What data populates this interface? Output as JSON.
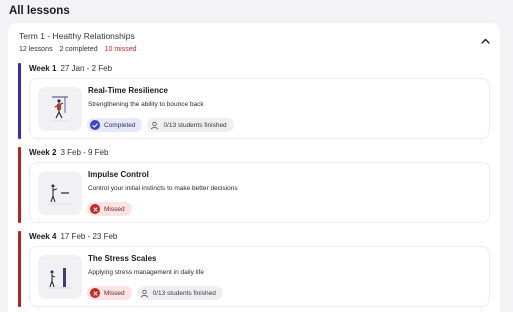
{
  "page": {
    "title": "All lessons"
  },
  "term": {
    "title": "Term 1 - Healthy Relationships",
    "lessons_count": "12 lessons",
    "completed_count": "2 completed",
    "missed_count": "10 missed"
  },
  "weeks": [
    {
      "label": "Week 1",
      "dates": "27 Jan - 2 Feb",
      "accent": "#3b2db3",
      "lesson": {
        "title": "Real-Time Resilience",
        "subtitle": "Strengthening the ability to bounce back",
        "status": "Completed",
        "students": "0/13 students finished"
      }
    },
    {
      "label": "Week 2",
      "dates": "3 Feb - 9 Feb",
      "accent": "#b3261e",
      "lesson": {
        "title": "Impulse Control",
        "subtitle": "Control your initial instincts to make better decisions",
        "status": "Missed"
      }
    },
    {
      "label": "Week 4",
      "dates": "17 Feb - 23 Feb",
      "accent": "#b3261e",
      "lesson": {
        "title": "The Stress Scales",
        "subtitle": "Applying stress management in daily life",
        "status": "Missed",
        "students": "0/13 students finished"
      }
    }
  ],
  "colors": {
    "completed": "#3b45c9",
    "missed": "#c62828"
  },
  "icons": {
    "collapse": "chevron-up-icon",
    "completed": "check-circle-icon",
    "missed": "x-circle-icon",
    "students": "user-icon"
  }
}
